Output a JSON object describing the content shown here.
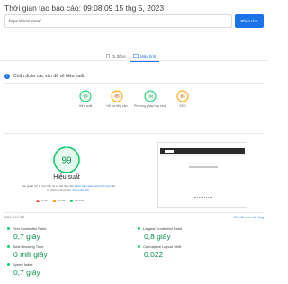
{
  "header": {
    "report_time": "Thời gian tạo báo cáo: 09:08:09 15 thg 5, 2023"
  },
  "search": {
    "url_value": "https://bioni.store/",
    "analyze_label": "Phân tích"
  },
  "tabs": [
    {
      "label": "Di động",
      "icon": "phone-icon",
      "active": false
    },
    {
      "label": "Máy tính",
      "icon": "desktop-icon",
      "active": true
    }
  ],
  "diagnose": {
    "label": "Chẩn đoán các vấn đề về hiệu suất"
  },
  "scores": [
    {
      "value": "99",
      "label": "Hiệu suất",
      "color": "#0cce6b"
    },
    {
      "value": "85",
      "label": "Hỗ trợ tiếp cận",
      "color": "#ffa400"
    },
    {
      "value": "100",
      "label": "Phương pháp hay nhất",
      "color": "#0cce6b"
    },
    {
      "value": "83",
      "label": "SEO",
      "color": "#ffa400"
    }
  ],
  "performance": {
    "score": "99",
    "score_fraction": 0.99,
    "title": "Hiệu suất",
    "note": "Các giá trị chỉ là ước tính và có thể thay đổi.",
    "note_link": "Điểm hiệu quả được tính trực",
    "note_2": "tiếp từ những chỉ số này.",
    "note_link_2": "Xem máy tính.",
    "legend": [
      {
        "label": "0–49",
        "shape": "triangle",
        "color": "#ff4e42"
      },
      {
        "label": "50–89",
        "shape": "square",
        "color": "#ffa400"
      },
      {
        "label": "90–100",
        "shape": "circle",
        "color": "#0cce6b"
      }
    ]
  },
  "metrics": {
    "header": "CÁC CHỈ SỐ",
    "expand_label": "Chế độ xem mở rộng",
    "items": [
      {
        "name": "First Contentful Paint",
        "value": "0,7 giây"
      },
      {
        "name": "Largest Contentful Paint",
        "value": "0,8 giây"
      },
      {
        "name": "Total Blocking Time",
        "value": "0 mili giây"
      },
      {
        "name": "Cumulative Layout Shift",
        "value": "0.022"
      },
      {
        "name": "Speed Index",
        "value": "0,7 giây"
      }
    ]
  },
  "colors": {
    "accent": "#1a73e8",
    "good": "#0cce6b",
    "good_text": "#0d904f",
    "average": "#ffa400",
    "poor": "#ff4e42"
  }
}
